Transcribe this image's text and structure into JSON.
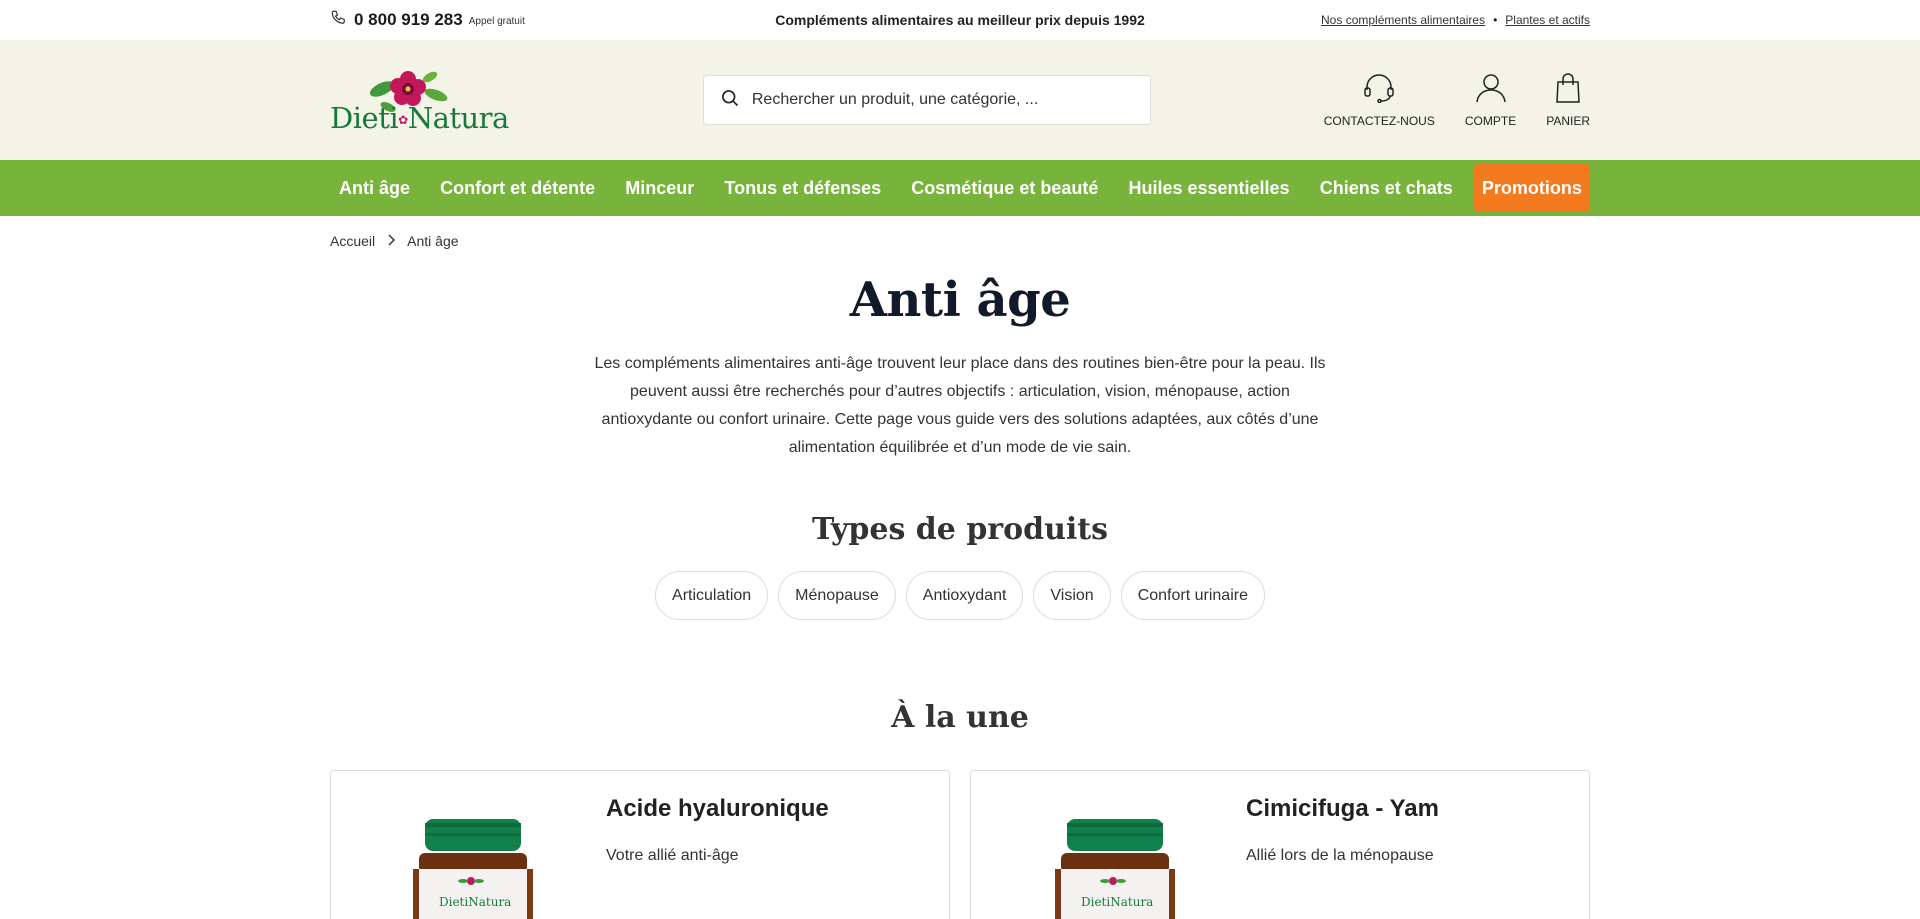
{
  "topbar": {
    "phone": "0 800 919 283",
    "phone_note": "Appel gratuit",
    "tagline": "Compléments alimentaires au meilleur prix depuis 1992",
    "links": [
      "Nos compléments alimentaires",
      "Plantes et actifs"
    ],
    "separator": "•"
  },
  "header": {
    "logo_left": "Dieti",
    "logo_right": "Natura",
    "search_placeholder": "Rechercher un produit, une catégorie, ...",
    "icons": [
      {
        "label": "CONTACTEZ-NOUS",
        "icon": "headset-icon"
      },
      {
        "label": "COMPTE",
        "icon": "user-icon"
      },
      {
        "label": "PANIER",
        "icon": "bag-icon"
      }
    ]
  },
  "nav": {
    "items": [
      "Anti âge",
      "Confort et détente",
      "Minceur",
      "Tonus et défenses",
      "Cosmétique et beauté",
      "Huiles essentielles",
      "Chiens et chats"
    ],
    "promo": "Promotions",
    "colors": {
      "nav_bg": "#78b43c",
      "promo_bg": "#f47a20"
    }
  },
  "breadcrumb": {
    "home": "Accueil",
    "current": "Anti âge"
  },
  "page": {
    "title": "Anti âge",
    "intro": "Les compléments alimentaires anti-âge trouvent leur place dans des routines bien-être pour la peau. Ils peuvent aussi être recherchés pour d’autres objectifs : articulation, vision, ménopause, action antioxydante ou confort urinaire. Cette page vous guide vers des solutions adaptées, aux côtés d’une alimentation équilibrée et d’un mode de vie sain.",
    "types_title": "Types de produits",
    "types": [
      "Articulation",
      "Ménopause",
      "Antioxydant",
      "Vision",
      "Confort urinaire"
    ],
    "featured_title": "À la une",
    "featured": [
      {
        "name": "Acide hyaluronique",
        "subtitle": "Votre allié anti-âge",
        "label_left": "Dieti",
        "label_right": "Natura"
      },
      {
        "name": "Cimicifuga - Yam",
        "subtitle": "Allié lors de la ménopause",
        "label_left": "Dieti",
        "label_right": "Natura"
      }
    ]
  }
}
